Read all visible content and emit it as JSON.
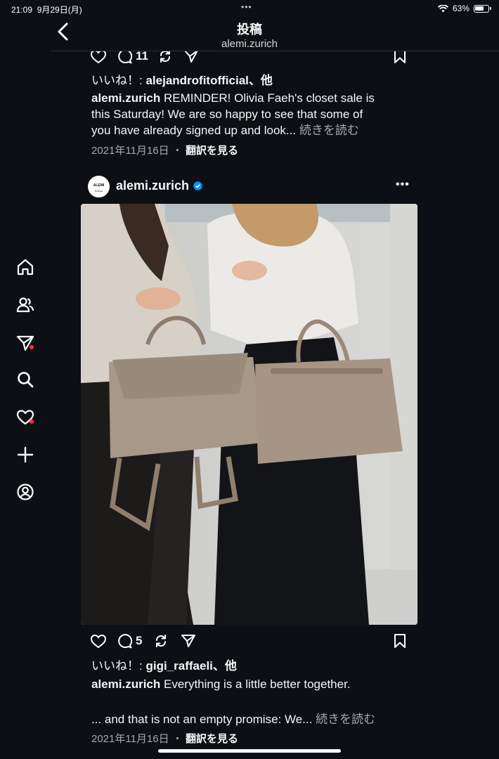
{
  "status": {
    "time": "21:09",
    "date": "9月29日(月)",
    "battery": "63%"
  },
  "header": {
    "title": "投稿",
    "subtitle": "alemi.zurich"
  },
  "post1": {
    "comment_count": "11",
    "likes_prefix": "いいね！:",
    "likes_user": "alejandrofitofficial",
    "likes_suffix": "、他",
    "caption_user": "alemi.zurich",
    "caption_line1": "REMINDER! Olivia Faeh's closet sale is",
    "caption_line2": "this Saturday! We are so happy to see that some of",
    "caption_line3": "you have already signed up and look...",
    "more": "続きを読む",
    "date": "2021年11月16日",
    "sep": "・",
    "translate": "翻訳を見る"
  },
  "post2": {
    "avatar_text_top": "ALEMI",
    "avatar_text_bottom": "ZURICH",
    "username": "alemi.zurich",
    "comment_count": "5",
    "likes_prefix": "いいね！:",
    "likes_user": "gigi_raffaeli",
    "likes_suffix": "、他",
    "caption_user": "alemi.zurich",
    "caption_line1": "Everything is a little better together.",
    "caption_line3": "... and that is not an empty promise: We...",
    "more": "続きを読む",
    "date": "2021年11月16日",
    "sep": "・",
    "translate": "翻訳を見る"
  },
  "sidebar": [
    "home-icon",
    "profiles-icon",
    "messages-icon",
    "search-icon",
    "activity-icon",
    "create-icon",
    "profile-icon"
  ],
  "colors": {
    "background": "#0c1014",
    "text": "#f5f5f5",
    "muted": "#a8a8a8",
    "notification": "#ff3040",
    "verified": "#0095f6"
  }
}
